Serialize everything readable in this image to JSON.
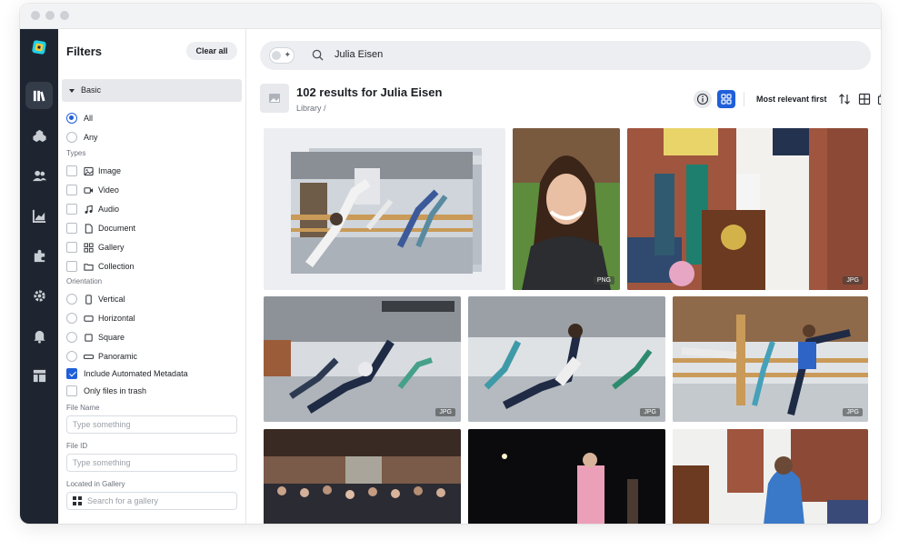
{
  "app": {
    "icons": [
      "library-icon",
      "structure-icon",
      "people-icon",
      "analytics-icon",
      "integrations-icon",
      "settings-icon",
      "bell-icon",
      "layout-icon"
    ],
    "accent": "#1f5fd9",
    "sidebar_bg": "#1f2530"
  },
  "filters": {
    "title": "Filters",
    "clear_all": "Clear all",
    "section": "Basic",
    "match": [
      {
        "label": "All",
        "selected": true
      },
      {
        "label": "Any",
        "selected": false
      }
    ],
    "types_label": "Types",
    "types": [
      {
        "label": "Image",
        "icon": "image-icon"
      },
      {
        "label": "Video",
        "icon": "video-icon"
      },
      {
        "label": "Audio",
        "icon": "audio-icon"
      },
      {
        "label": "Document",
        "icon": "document-icon"
      },
      {
        "label": "Gallery",
        "icon": "gallery-icon"
      },
      {
        "label": "Collection",
        "icon": "folder-icon"
      }
    ],
    "orientation_label": "Orientation",
    "orientation": [
      {
        "label": "Vertical",
        "icon": "vertical-icon"
      },
      {
        "label": "Horizontal",
        "icon": "horizontal-icon"
      },
      {
        "label": "Square",
        "icon": "square-icon"
      },
      {
        "label": "Panoramic",
        "icon": "panoramic-icon"
      }
    ],
    "include_metadata": {
      "label": "Include Automated Metadata",
      "checked": true
    },
    "only_trash": {
      "label": "Only files in trash",
      "checked": false
    },
    "file_name": {
      "label": "File Name",
      "placeholder": "Type something"
    },
    "file_id": {
      "label": "File ID",
      "placeholder": "Type something"
    },
    "gallery": {
      "label": "Located in Gallery",
      "placeholder": "Search for a gallery"
    }
  },
  "search": {
    "query": "Julia Eisen"
  },
  "results": {
    "title": "102 results for Julia Eisen",
    "breadcrumb": "Library /",
    "sort_label": "Most relevant first",
    "tiles": [
      {
        "name": "dance-class-collage",
        "badge": ""
      },
      {
        "name": "portrait-julia",
        "badge": "PNG"
      },
      {
        "name": "podium-speech",
        "badge": "JPG"
      },
      {
        "name": "dance-lunge-1",
        "badge": "JPG"
      },
      {
        "name": "dance-lunge-2",
        "badge": "JPG"
      },
      {
        "name": "dance-barre",
        "badge": "JPG"
      },
      {
        "name": "crowd-hall",
        "badge": ""
      },
      {
        "name": "stage-speaker",
        "badge": ""
      },
      {
        "name": "hug-outdoor",
        "badge": ""
      }
    ]
  }
}
